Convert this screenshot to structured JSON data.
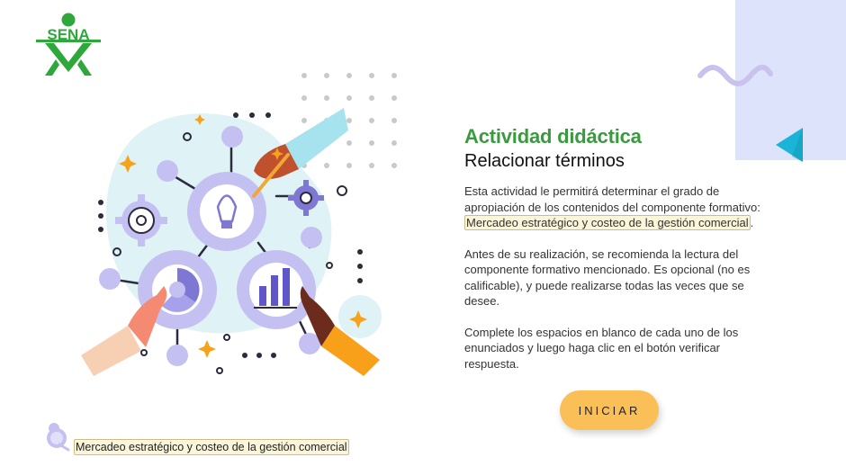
{
  "brand": {
    "logo_text": "SENA",
    "logo_color": "#2ea83a"
  },
  "header": {
    "title": "Actividad didáctica",
    "subtitle": "Relacionar términos"
  },
  "intro": {
    "paragraph1_before": "Esta actividad le permitirá determinar el grado de apropiación de los contenidos del componente formativo: ",
    "paragraph1_highlight": "Mercadeo estratégico y costeo de la gestión comercial",
    "paragraph1_after": ".",
    "paragraph2": "Antes de su realización, se recomienda la lectura del componente formativo mencionado. Es opcional (no es calificable), y puede realizarse todas las veces que se desee.",
    "paragraph3": "Complete los espacios en blanco de cada uno de los enunciados y luego haga clic en el botón verificar respuesta."
  },
  "actions": {
    "start_label": "INICIAR"
  },
  "footer": {
    "course_label": "Mercadeo estratégico y costeo de la gestión comercial"
  },
  "icons": {
    "back": "back-arrow-icon",
    "footer": "course-badge-icon",
    "decor": "squiggle-icon"
  },
  "colors": {
    "title_green": "#3a9a3f",
    "accent_cyan": "#1ab4d6",
    "button_yellow": "#fbbf58",
    "panel_lavender": "#dde3fb",
    "highlight_bg": "#fbf6d9"
  }
}
